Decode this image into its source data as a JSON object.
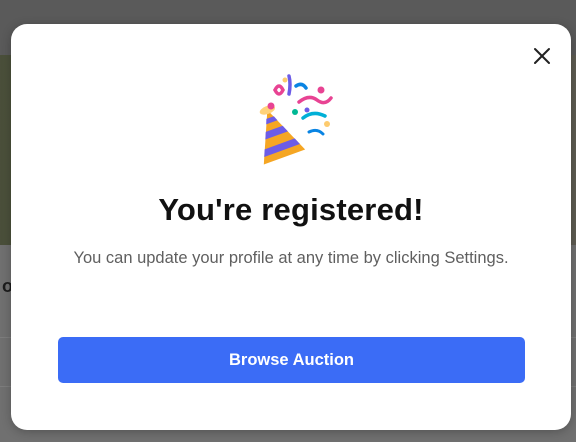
{
  "modal": {
    "title": "You're registered!",
    "message": "You can update your profile at any time by clicking Settings.",
    "primary_button_label": "Browse Auction",
    "close_icon": "close-icon",
    "illustration_icon": "party-popper-icon"
  },
  "colors": {
    "primary_button": "#3b6cf6",
    "title_text": "#111111",
    "body_text": "#5f5f5f",
    "overlay": "#5a5a5a"
  }
}
